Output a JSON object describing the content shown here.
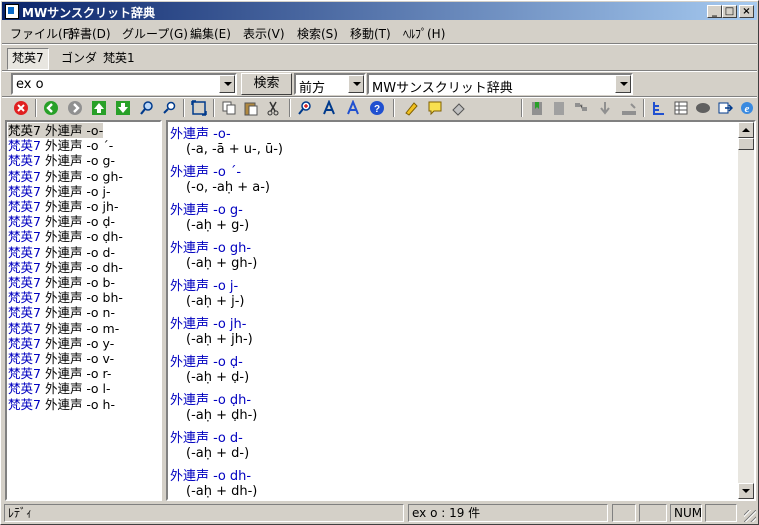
{
  "window": {
    "title": "MWサンスクリット辞典"
  },
  "menu": [
    "ファイル(F)",
    "辞書(D)",
    "グループ(G)",
    "編集(E)",
    "表示(V)",
    "検索(S)",
    "移動(T)",
    "ﾍﾙﾌﾟ(H)"
  ],
  "tabs": [
    "梵英7",
    "ゴンダ",
    "梵英1"
  ],
  "search": {
    "query": "ex o",
    "button_label": "検索",
    "mode": "前方",
    "dictionary": "MWサンスクリット辞典"
  },
  "toolbar_icons": [
    "stop-icon",
    "back-icon",
    "forward-icon",
    "up-icon",
    "down-icon",
    "search-icon",
    "search-small-icon",
    "fit-icon",
    "copy-icon",
    "paste-icon",
    "cut-icon",
    "zoom-in-icon",
    "font-a-icon",
    "font-a-blue-icon",
    "help-icon",
    "marker-icon",
    "comment-icon",
    "eraser-icon",
    "bookmark-icon",
    "file-icon",
    "layout-icon",
    "arrow-icon",
    "sort-icon",
    "tree-icon",
    "grid-icon",
    "cloud-icon",
    "export-icon",
    "browser-icon"
  ],
  "list": [
    {
      "dict": "梵英7",
      "text": "外連声 -o-"
    },
    {
      "dict": "梵英7",
      "text": "外連声 -o ´-"
    },
    {
      "dict": "梵英7",
      "text": "外連声 -o g-"
    },
    {
      "dict": "梵英7",
      "text": "外連声 -o gh-"
    },
    {
      "dict": "梵英7",
      "text": "外連声 -o j-"
    },
    {
      "dict": "梵英7",
      "text": "外連声 -o jh-"
    },
    {
      "dict": "梵英7",
      "text": "外連声 -o ḍ-"
    },
    {
      "dict": "梵英7",
      "text": "外連声 -o ḍh-"
    },
    {
      "dict": "梵英7",
      "text": "外連声 -o d-"
    },
    {
      "dict": "梵英7",
      "text": "外連声 -o dh-"
    },
    {
      "dict": "梵英7",
      "text": "外連声 -o b-"
    },
    {
      "dict": "梵英7",
      "text": "外連声 -o bh-"
    },
    {
      "dict": "梵英7",
      "text": "外連声 -o n-"
    },
    {
      "dict": "梵英7",
      "text": "外連声 -o m-"
    },
    {
      "dict": "梵英7",
      "text": "外連声 -o y-"
    },
    {
      "dict": "梵英7",
      "text": "外連声 -o v-"
    },
    {
      "dict": "梵英7",
      "text": "外連声 -o r-"
    },
    {
      "dict": "梵英7",
      "text": "外連声 -o l-"
    },
    {
      "dict": "梵英7",
      "text": "外連声 -o h-"
    }
  ],
  "entries": [
    {
      "head": "外連声 -o-",
      "body": "(-a, -ā + u-, ū-)"
    },
    {
      "head": "外連声 -o ´-",
      "body": "(-o, -aḥ + a-)"
    },
    {
      "head": "外連声 -o g-",
      "body": "(-aḥ + g-)"
    },
    {
      "head": "外連声 -o gh-",
      "body": "(-aḥ + gh-)"
    },
    {
      "head": "外連声 -o j-",
      "body": "(-aḥ + j-)"
    },
    {
      "head": "外連声 -o jh-",
      "body": "(-aḥ + jh-)"
    },
    {
      "head": "外連声 -o ḍ-",
      "body": "(-aḥ + ḍ-)"
    },
    {
      "head": "外連声 -o ḍh-",
      "body": "(-aḥ + ḍh-)"
    },
    {
      "head": "外連声 -o d-",
      "body": "(-aḥ + d-)"
    },
    {
      "head": "外連声 -o dh-",
      "body": "(-aḥ + dh-)"
    }
  ],
  "status": {
    "ready": "ﾚﾃﾞｨ",
    "count": "ex o : 19 件",
    "num": "NUM"
  }
}
